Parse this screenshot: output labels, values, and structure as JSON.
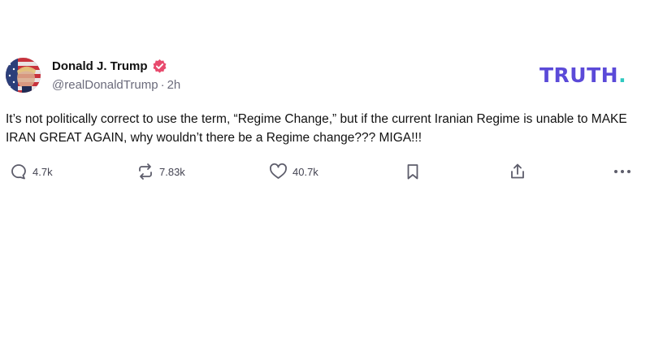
{
  "author": {
    "display_name": "Donald J. Trump",
    "handle": "@realDonaldTrump",
    "timestamp": "2h",
    "separator": "·",
    "verified_icon": "verified-badge-icon"
  },
  "brand": {
    "text": "TRUTH",
    "dot": ".",
    "color": "#5b4ad8",
    "dot_color": "#2fc9c0"
  },
  "post": {
    "text": "It’s not politically correct to use the term, “Regime Change,” but if the current Iranian Regime is unable to MAKE IRAN GREAT AGAIN, why wouldn’t there be a Regime change??? MIGA!!!"
  },
  "actions": {
    "replies": "4.7k",
    "retruths": "7.83k",
    "likes": "40.7k",
    "icons": [
      "reply-icon",
      "retruth-icon",
      "like-icon",
      "bookmark-icon",
      "share-icon",
      "more-icon"
    ]
  },
  "colors": {
    "verified": "#e84a6d",
    "muted_text": "#6b6b7b",
    "icon": "#5d5d6b"
  }
}
